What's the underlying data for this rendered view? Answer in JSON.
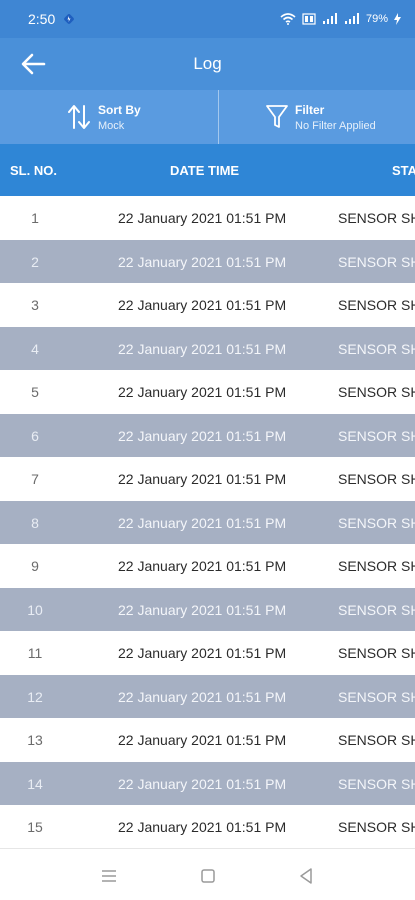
{
  "status_bar": {
    "time": "2:50",
    "battery": "79%",
    "icons": [
      "app-notification-icon",
      "wifi-icon",
      "volte-icon",
      "signal-icon",
      "signal-icon",
      "charging-icon"
    ]
  },
  "app_bar": {
    "title": "Log",
    "back_icon": "arrow-left-icon"
  },
  "toolbar": {
    "sort_title": "Sort By",
    "sort_value": "Mock",
    "sort_icon": "sort-arrows-icon",
    "filter_title": "Filter",
    "filter_value": "No Filter Applied",
    "filter_icon": "funnel-icon"
  },
  "table": {
    "headers": [
      "SL. NO.",
      "DATE TIME",
      "STATUS"
    ],
    "rows": [
      {
        "sl": "1",
        "datetime": "22 January 2021 01:51 PM",
        "status": "SENSOR SHORT"
      },
      {
        "sl": "2",
        "datetime": "22 January 2021 01:51 PM",
        "status": "SENSOR SHORT"
      },
      {
        "sl": "3",
        "datetime": "22 January 2021 01:51 PM",
        "status": "SENSOR SHORT"
      },
      {
        "sl": "4",
        "datetime": "22 January 2021 01:51 PM",
        "status": "SENSOR SHORT"
      },
      {
        "sl": "5",
        "datetime": "22 January 2021 01:51 PM",
        "status": "SENSOR SHORT"
      },
      {
        "sl": "6",
        "datetime": "22 January 2021 01:51 PM",
        "status": "SENSOR SHORT"
      },
      {
        "sl": "7",
        "datetime": "22 January 2021 01:51 PM",
        "status": "SENSOR SHORT"
      },
      {
        "sl": "8",
        "datetime": "22 January 2021 01:51 PM",
        "status": "SENSOR SHORT"
      },
      {
        "sl": "9",
        "datetime": "22 January 2021 01:51 PM",
        "status": "SENSOR SHORT"
      },
      {
        "sl": "10",
        "datetime": "22 January 2021 01:51 PM",
        "status": "SENSOR SHORT"
      },
      {
        "sl": "11",
        "datetime": "22 January 2021 01:51 PM",
        "status": "SENSOR SHORT"
      },
      {
        "sl": "12",
        "datetime": "22 January 2021 01:51 PM",
        "status": "SENSOR SHORT"
      },
      {
        "sl": "13",
        "datetime": "22 January 2021 01:51 PM",
        "status": "SENSOR SHORT"
      },
      {
        "sl": "14",
        "datetime": "22 January 2021 01:51 PM",
        "status": "SENSOR SHORT"
      },
      {
        "sl": "15",
        "datetime": "22 January 2021 01:51 PM",
        "status": "SENSOR SHORT"
      }
    ]
  },
  "nav_bar": {
    "icons": [
      "menu-icon",
      "home-icon",
      "back-triangle-icon"
    ]
  },
  "colors": {
    "status_bar": "#3f86d3",
    "app_bar": "#4a90d9",
    "toolbar": "#5a9be0",
    "table_header": "#2f86d6",
    "row_alt": "#a6b0c3",
    "row": "#ffffff"
  }
}
